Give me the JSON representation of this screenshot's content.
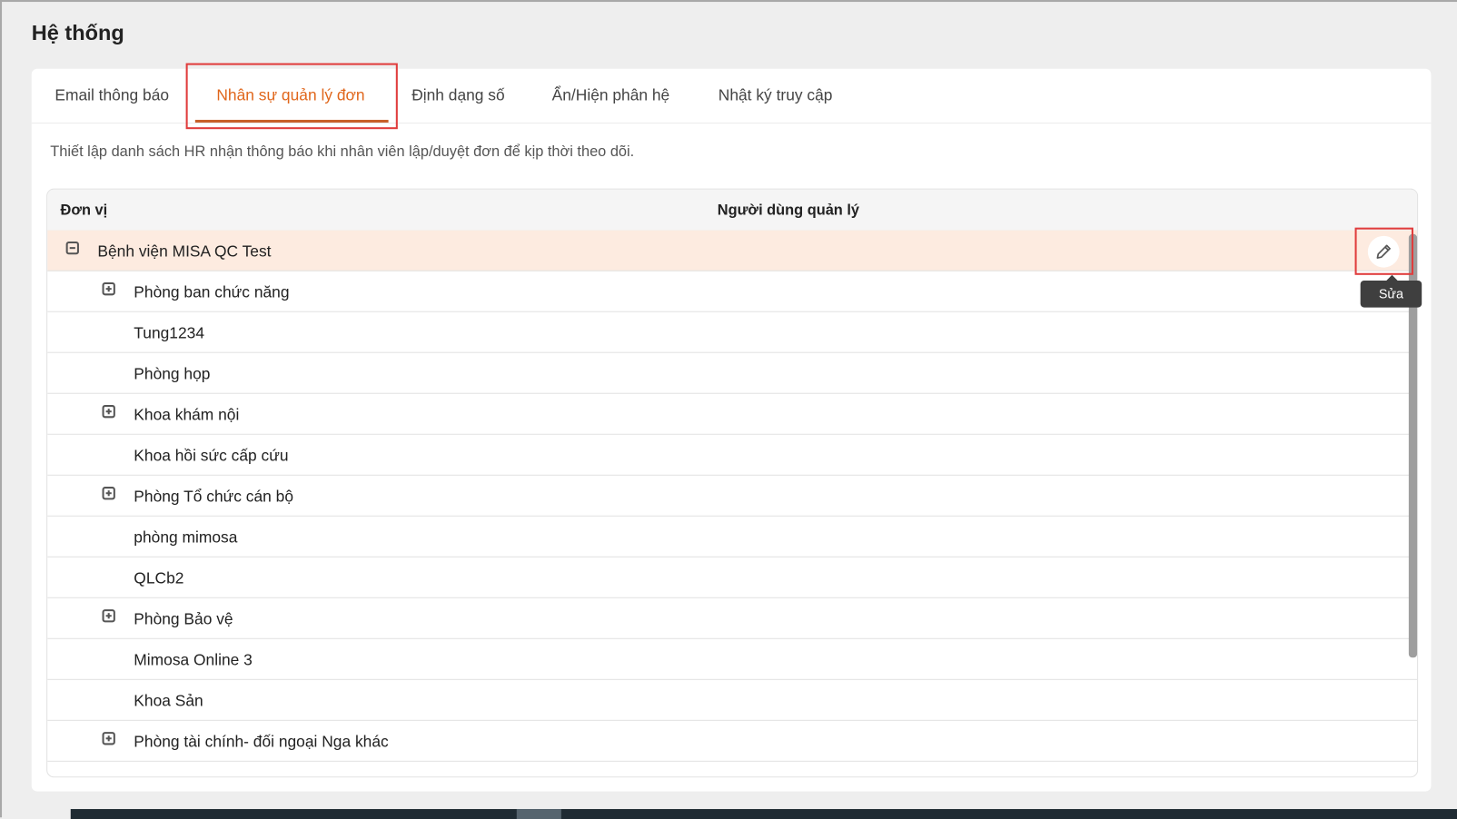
{
  "page_title": "Hệ thống",
  "tabs": [
    {
      "label": "Email thông báo",
      "active": false
    },
    {
      "label": "Nhân sự quản lý đơn",
      "active": true
    },
    {
      "label": "Định dạng số",
      "active": false
    },
    {
      "label": "Ẩn/Hiện phân hệ",
      "active": false
    },
    {
      "label": "Nhật ký truy cập",
      "active": false
    }
  ],
  "description": "Thiết lập danh sách HR nhận thông báo khi nhân viên lập/duyệt đơn để kịp thời theo dõi.",
  "table": {
    "columns": [
      "Đơn vị",
      "Người dùng quản lý"
    ],
    "rows": [
      {
        "name": "Bệnh viện MISA QC Test",
        "level": 0,
        "expander": "collapse"
      },
      {
        "name": "Phòng ban chức năng",
        "level": 1,
        "expander": "expand"
      },
      {
        "name": "Tung1234",
        "level": 1,
        "expander": "none"
      },
      {
        "name": "Phòng họp",
        "level": 1,
        "expander": "none"
      },
      {
        "name": "Khoa khám nội",
        "level": 1,
        "expander": "expand"
      },
      {
        "name": "Khoa hồi sức cấp cứu",
        "level": 1,
        "expander": "none"
      },
      {
        "name": "Phòng Tổ chức cán bộ",
        "level": 1,
        "expander": "expand"
      },
      {
        "name": "phòng mimosa",
        "level": 1,
        "expander": "none"
      },
      {
        "name": "QLCb2",
        "level": 1,
        "expander": "none"
      },
      {
        "name": "Phòng Bảo vệ",
        "level": 1,
        "expander": "expand"
      },
      {
        "name": "Mimosa Online 3",
        "level": 1,
        "expander": "none"
      },
      {
        "name": "Khoa Sản",
        "level": 1,
        "expander": "none"
      },
      {
        "name": "Phòng tài chính- đối ngoại Nga khác",
        "level": 1,
        "expander": "expand"
      }
    ]
  },
  "edit_tooltip": "Sửa",
  "colors": {
    "accent": "#e0661b",
    "selected_row": "#fdebe0",
    "highlight": "#e03c3c"
  }
}
